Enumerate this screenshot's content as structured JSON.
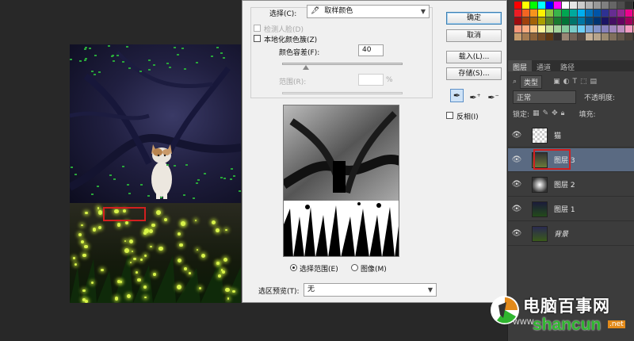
{
  "dialog": {
    "select_label": "选择(C):",
    "select_value": "取样颜色",
    "detect_faces": "检测人脸(D)",
    "localized_clusters": "本地化颜色簇(Z)",
    "fuzziness_label": "颜色容差(F):",
    "fuzziness_value": "40",
    "range_label": "范围(R):",
    "range_unit": "%",
    "radio_selection": "选择范围(E)",
    "radio_image": "图像(M)",
    "preview_label": "选区预览(T):",
    "preview_value": "无",
    "ok": "确定",
    "cancel": "取消",
    "load": "载入(L)...",
    "save": "存储(S)...",
    "invert": "反相(I)",
    "tools": [
      "eyedropper-icon",
      "eyedropper-plus-icon",
      "eyedropper-minus-icon"
    ]
  },
  "layers_panel": {
    "tabs": [
      "图层",
      "通道",
      "路径"
    ],
    "filter_label": "类型",
    "blend_mode": "正常",
    "opacity_label": "不透明度:",
    "lock_label": "锁定:",
    "fill_label": "填充:",
    "layers": [
      {
        "name": "猫",
        "selected": false
      },
      {
        "name": "图层 3",
        "selected": true
      },
      {
        "name": "图层 2",
        "selected": false
      },
      {
        "name": "图层 1",
        "selected": false
      },
      {
        "name": "背景",
        "selected": false
      }
    ]
  },
  "watermark": {
    "title": "电脑百事网",
    "url_prefix": "WWW.",
    "url": "shancun",
    "url_suffix": ".net"
  },
  "colors": {
    "selection_highlight": "#d21f1f",
    "selected_layer": "#5a6a82"
  }
}
